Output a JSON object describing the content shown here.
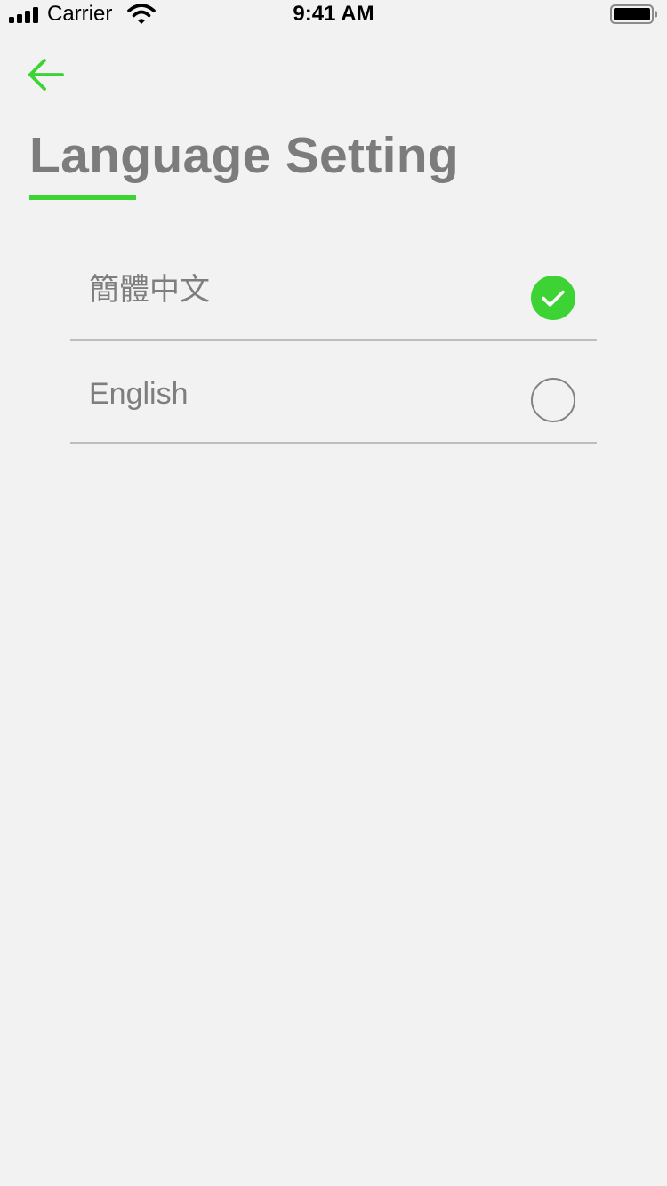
{
  "status_bar": {
    "carrier": "Carrier",
    "time": "9:41 AM",
    "icons": [
      "signal-icon",
      "wifi-icon",
      "battery-icon"
    ]
  },
  "header": {
    "back_icon": "arrow-left-icon",
    "title": "Language Setting"
  },
  "languages": [
    {
      "label": "簡體中文",
      "selected": true
    },
    {
      "label": "English",
      "selected": false
    }
  ],
  "colors": {
    "accent": "#3dd334",
    "text": "#7c7c7c",
    "background": "#f2f2f2",
    "divider": "#bdbdbd"
  }
}
